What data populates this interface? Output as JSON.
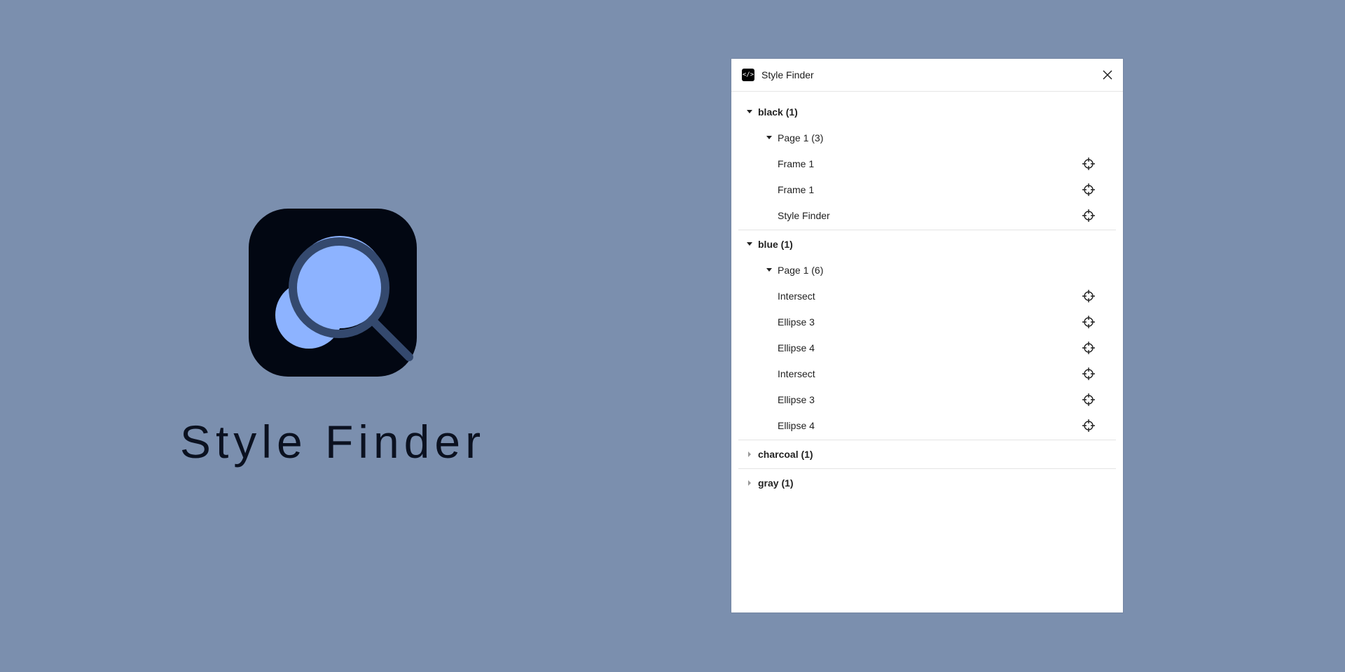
{
  "hero": {
    "title": "Style Finder",
    "logo_icon": "magnifier-logo-icon",
    "colors": {
      "background": "#7b8fae",
      "logo_bg": "#020712",
      "logo_fill": "#8db3ff",
      "logo_ring": "#34496e"
    }
  },
  "window": {
    "title": "Style Finder",
    "app_icon": "</>",
    "close_icon": "close-icon"
  },
  "tree": {
    "black": {
      "label": "black (1)",
      "page": {
        "label": "Page 1 (3)",
        "items": [
          "Frame 1",
          "Frame 1",
          "Style Finder"
        ]
      }
    },
    "blue": {
      "label": "blue (1)",
      "page": {
        "label": "Page 1 (6)",
        "items": [
          "Intersect",
          "Ellipse 3",
          "Ellipse 4",
          "Intersect",
          "Ellipse 3",
          "Ellipse 4"
        ]
      }
    },
    "charcoal": {
      "label": "charcoal (1)"
    },
    "gray": {
      "label": "gray (1)"
    }
  }
}
